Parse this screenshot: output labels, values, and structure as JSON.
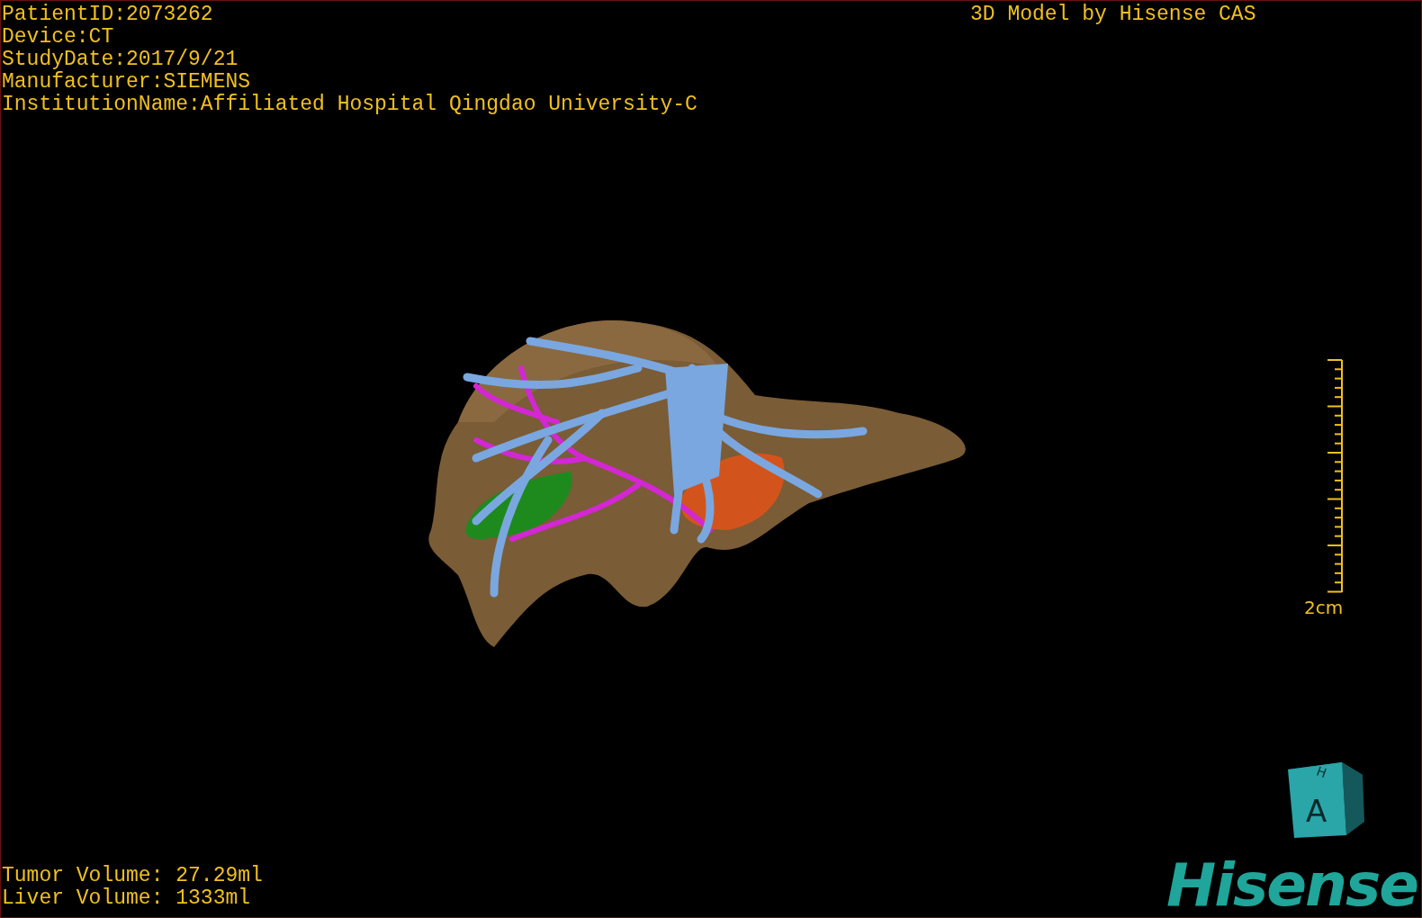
{
  "study_info": [
    "PatientID:2073262",
    "Device:CT",
    "StudyDate:2017/9/21",
    "Manufacturer:SIEMENS",
    "InstitutionName:Affiliated Hospital Qingdao University-C"
  ],
  "title": "3D Model by Hisense CAS",
  "scale_bar": {
    "label": "2cm"
  },
  "volumes": [
    "Tumor Volume: 27.29ml",
    "Liver Volume: 1333ml"
  ],
  "orientation_cube": {
    "front": "A",
    "top": "H"
  },
  "logo": "Hisense"
}
